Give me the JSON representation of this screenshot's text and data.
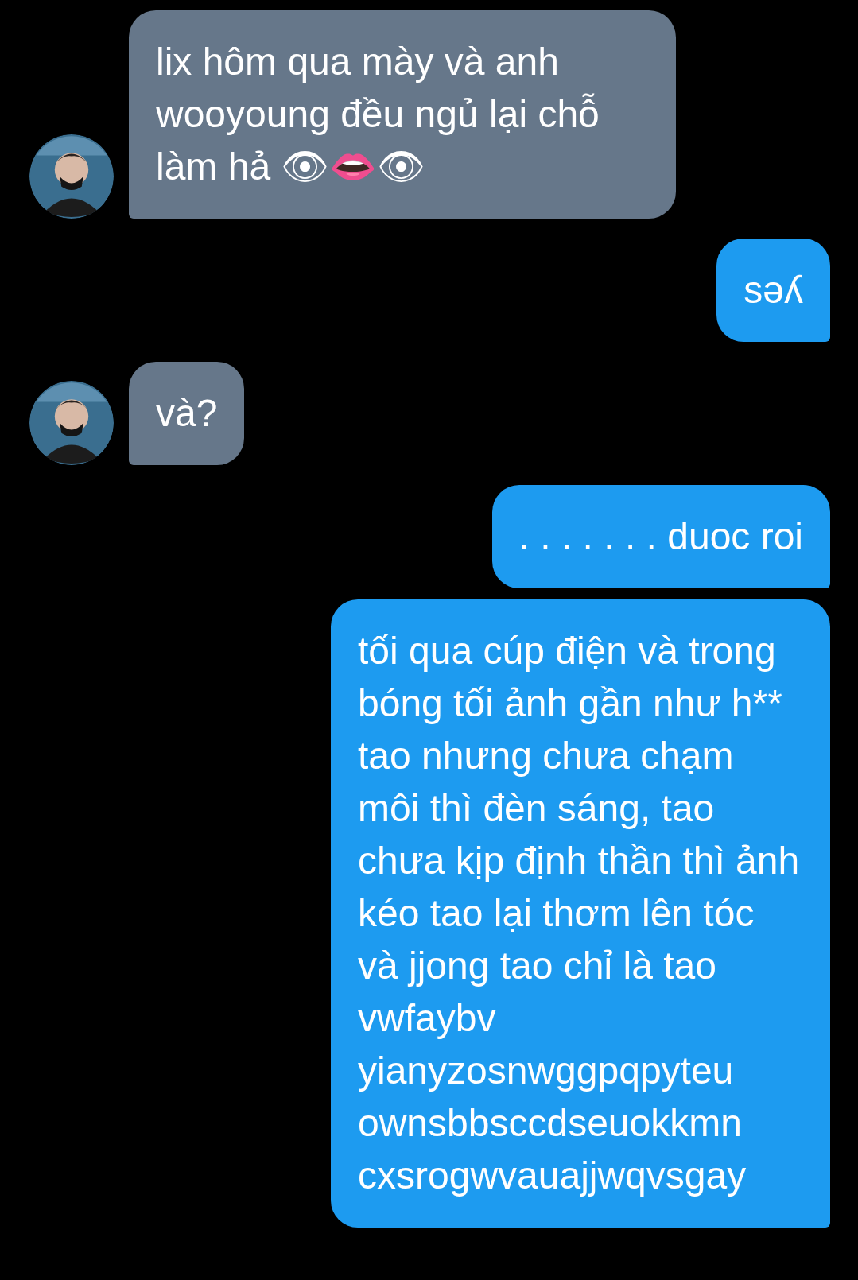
{
  "messages": [
    {
      "kind": "incoming",
      "text": "lix hôm qua mày và anh wooyoung đều ngủ lại chỗ làm hả 👁👄👁"
    },
    {
      "kind": "outgoing",
      "text": "sǝʎ"
    },
    {
      "kind": "incoming",
      "text": "và?"
    },
    {
      "kind": "outgoing",
      "text": ". . . . . . . duoc roi"
    },
    {
      "kind": "outgoing",
      "text": "tối qua cúp điện và trong bóng tối ảnh gần như h** tao nhưng chưa chạm môi thì đèn sáng, tao chưa kịp định thần thì ảnh kéo tao lại thơm lên tóc và jjong tao chỉ là tao vwfaybv yianyzosnwggpqpyteu ownsbbsccdseuokkmn cxsrogwvauajjwqvsgay"
    }
  ]
}
